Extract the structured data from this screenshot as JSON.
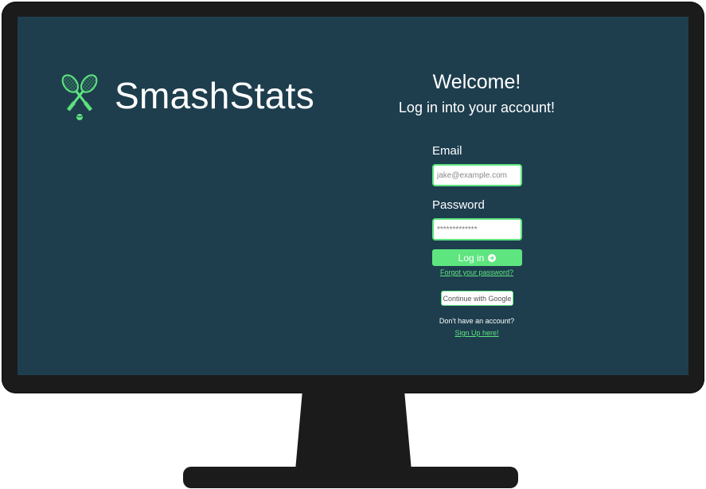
{
  "brand": {
    "name": "SmashStats",
    "logo_icon": "crossed-tennis-rackets-icon"
  },
  "login": {
    "title": "Welcome!",
    "subtitle": "Log in into your account!",
    "email": {
      "label": "Email",
      "placeholder": "jake@example.com",
      "value": ""
    },
    "password": {
      "label": "Password",
      "value": "*************"
    },
    "login_button": {
      "label": "Log in",
      "icon": "arrow-right-circle-icon"
    },
    "forgot_link": "Forgot your password?",
    "google_button": "Continue with Google",
    "no_account_text": "Don't have an account?",
    "signup_link": "Sign Up here!"
  },
  "colors": {
    "screen_bg": "#1e3e4e",
    "accent": "#5ee57f",
    "bezel": "#1b1b1b",
    "text": "#ffffff"
  }
}
